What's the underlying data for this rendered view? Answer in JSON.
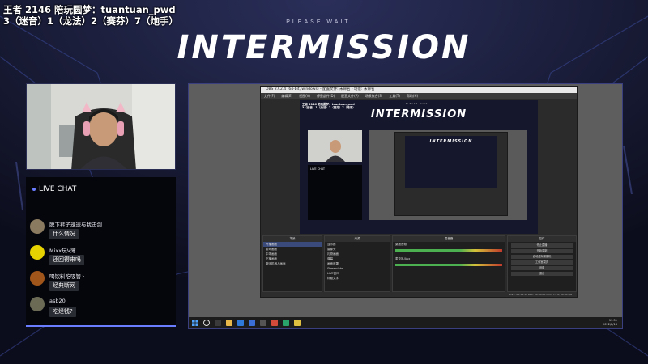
{
  "header": {
    "line1": "王者 2146  陪玩圆梦：tuantuan_pwd",
    "line2": "3（迷音）1（龙法）2（赛芬）7（炮手）"
  },
  "banner": {
    "subtitle": "PLEASE WAIT...",
    "title": "INTERMISSION"
  },
  "chat": {
    "header": "LIVE CHAT",
    "messages": [
      {
        "user": "脱下裤子速速与我击剑",
        "text": "什么情况",
        "avatar_color": "#8a7a60"
      },
      {
        "user": "Mixx玩V薄",
        "text": "还回得来吗",
        "avatar_color": "#e6d200"
      },
      {
        "user": "喝饮料吃吸管丶",
        "text": "经典断网",
        "avatar_color": "#a0561a"
      },
      {
        "user": "asb20",
        "text": "吃烂钱?",
        "avatar_color": "#6b6b55"
      }
    ]
  },
  "obs": {
    "title": "OBS 27.2.4 (64-bit, windows) - 配置文件: 未命名 - 场景: 未命名",
    "menu": [
      "文件(F)",
      "编辑(E)",
      "视图(V)",
      "停靠部件(D)",
      "配置文件(P)",
      "场景集合(S)",
      "工具(T)",
      "帮助(H)"
    ],
    "preview": {
      "subtitle": "PLEASE WAIT...",
      "title": "INTERMISSION",
      "overlay_line1": "王者 2146  陪玩圆梦：tuantuan_pwd",
      "overlay_line2": "3（迷音）1（龙法）2（赛芬）7（炮手）",
      "chat_label": "LIVE CHAT",
      "nested_title": "INTERMISSION"
    },
    "docks": {
      "scenes": {
        "header": "场景",
        "rows": [
          "开播画面",
          "游戏画面",
          "中场画面",
          "下播画面",
          "聊天机器人画面"
        ]
      },
      "sources": {
        "header": "来源",
        "rows": [
          "显示器",
          "摄像头",
          "礼物画面",
          "弹幕",
          "画面遮罩",
          "Streamlabs",
          "LIVE窗口",
          "标题文字"
        ]
      },
      "mixer": {
        "header": "混音器",
        "channels": [
          "桌面音频",
          "麦克风/Aux"
        ]
      },
      "controls": {
        "header": "控件",
        "buttons": [
          "停止直播",
          "开始录制",
          "启动虚拟摄像机",
          "工作室模式",
          "设置",
          "退出"
        ]
      }
    },
    "status": "LIVE: 00:34:11  REC: 00:00:00  CPU: 7.4%, 60.00 fps"
  },
  "taskbar": {
    "time": "19:51",
    "date": "2022/8/16"
  },
  "colors": {
    "accent": "#6a7cff",
    "background": "#121428"
  }
}
